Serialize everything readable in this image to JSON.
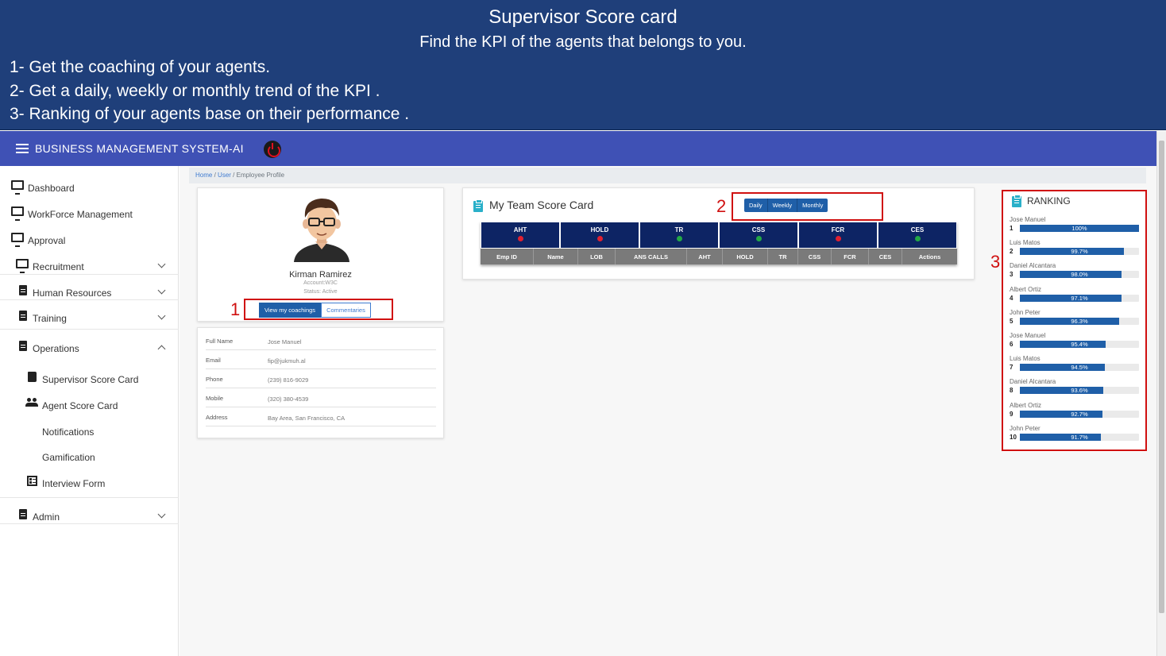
{
  "banner": {
    "title": "Supervisor Score card",
    "subtitle": "Find the KPI of the agents that belongs to you.",
    "lines": [
      "1- Get the coaching of your agents.",
      "2- Get a daily, weekly or monthly trend of the KPI .",
      "3- Ranking of your agents base on their performance ."
    ]
  },
  "appbar": {
    "title": "BUSINESS MANAGEMENT SYSTEM-AI",
    "menu_icon": "hamburger-menu",
    "power_icon": "power"
  },
  "sidebar": {
    "items": [
      {
        "label": "Dashboard",
        "icon": "monitor"
      },
      {
        "label": "WorkForce Management",
        "icon": "monitor"
      },
      {
        "label": "Approval",
        "icon": "monitor"
      },
      {
        "label": "Recruitment",
        "icon": "monitor"
      },
      {
        "label": "Human Resources",
        "icon": "document"
      },
      {
        "label": "Training",
        "icon": "document"
      },
      {
        "label": "Operations",
        "icon": "document"
      },
      {
        "label": "Supervisor Score Card",
        "icon": "book"
      },
      {
        "label": "Agent Score Card",
        "icon": "people"
      },
      {
        "label": "Notifications"
      },
      {
        "label": "Gamification"
      },
      {
        "label": "Interview Form",
        "icon": "form"
      },
      {
        "label": "Admin",
        "icon": "document"
      }
    ]
  },
  "breadcrumb": {
    "home": "Home",
    "user": "User",
    "current": "Employee Profile",
    "sep": "/"
  },
  "profile": {
    "name": "Kirman Ramirez",
    "account": "Account:W3C",
    "status": "Status: Active",
    "coachings_button": "View my coachings",
    "commentaries_button": "Commentaries",
    "details": [
      {
        "key": "Full Name",
        "value": "Jose Manuel"
      },
      {
        "key": "Email",
        "value": "fip@jukmuh.al"
      },
      {
        "key": "Phone",
        "value": "(239) 816-9029"
      },
      {
        "key": "Mobile",
        "value": "(320) 380-4539"
      },
      {
        "key": "Address",
        "value": "Bay Area, San Francisco, CA"
      }
    ]
  },
  "scorecard": {
    "title": "My Team Score Card",
    "periods": [
      "Daily",
      "Weekly",
      "Monthly"
    ],
    "kpis": [
      {
        "name": "AHT",
        "status": "red"
      },
      {
        "name": "HOLD",
        "status": "red"
      },
      {
        "name": "TR",
        "status": "green"
      },
      {
        "name": "CSS",
        "status": "green"
      },
      {
        "name": "FCR",
        "status": "red"
      },
      {
        "name": "CES",
        "status": "green"
      }
    ],
    "columns": [
      "Emp ID",
      "Name",
      "LOB",
      "ANS CALLS",
      "AHT",
      "HOLD",
      "TR",
      "CSS",
      "FCR",
      "CES",
      "Actions"
    ]
  },
  "ranking": {
    "title": "RANKING",
    "items": [
      {
        "pos": "1",
        "name": "Jose Manuel",
        "value": "100%",
        "pct": 100
      },
      {
        "pos": "2",
        "name": "Luis Matos",
        "value": "99.7%",
        "pct": 87
      },
      {
        "pos": "3",
        "name": "Daniel Alcantara",
        "value": "98.0%",
        "pct": 85
      },
      {
        "pos": "4",
        "name": "Albert Ortiz",
        "value": "97.1%",
        "pct": 85
      },
      {
        "pos": "5",
        "name": "John Peter",
        "value": "96.3%",
        "pct": 83
      },
      {
        "pos": "6",
        "name": "Jose Manuel",
        "value": "95.4%",
        "pct": 72
      },
      {
        "pos": "7",
        "name": "Luis Matos",
        "value": "94.5%",
        "pct": 71
      },
      {
        "pos": "8",
        "name": "Daniel Alcantara",
        "value": "93.6%",
        "pct": 70
      },
      {
        "pos": "9",
        "name": "Albert Ortiz",
        "value": "92.7%",
        "pct": 69
      },
      {
        "pos": "10",
        "name": "John Peter",
        "value": "91.7%",
        "pct": 68
      }
    ]
  },
  "annotations": {
    "n1": "1",
    "n2": "2",
    "n3": "3"
  },
  "colors": {
    "banner": "#1f3f7a",
    "appbar": "#3f51b5",
    "accent": "#1f5fa8",
    "kpi_header": "#0d2464",
    "red": "#e02030",
    "green": "#22a845",
    "annotation": "#d01010"
  }
}
